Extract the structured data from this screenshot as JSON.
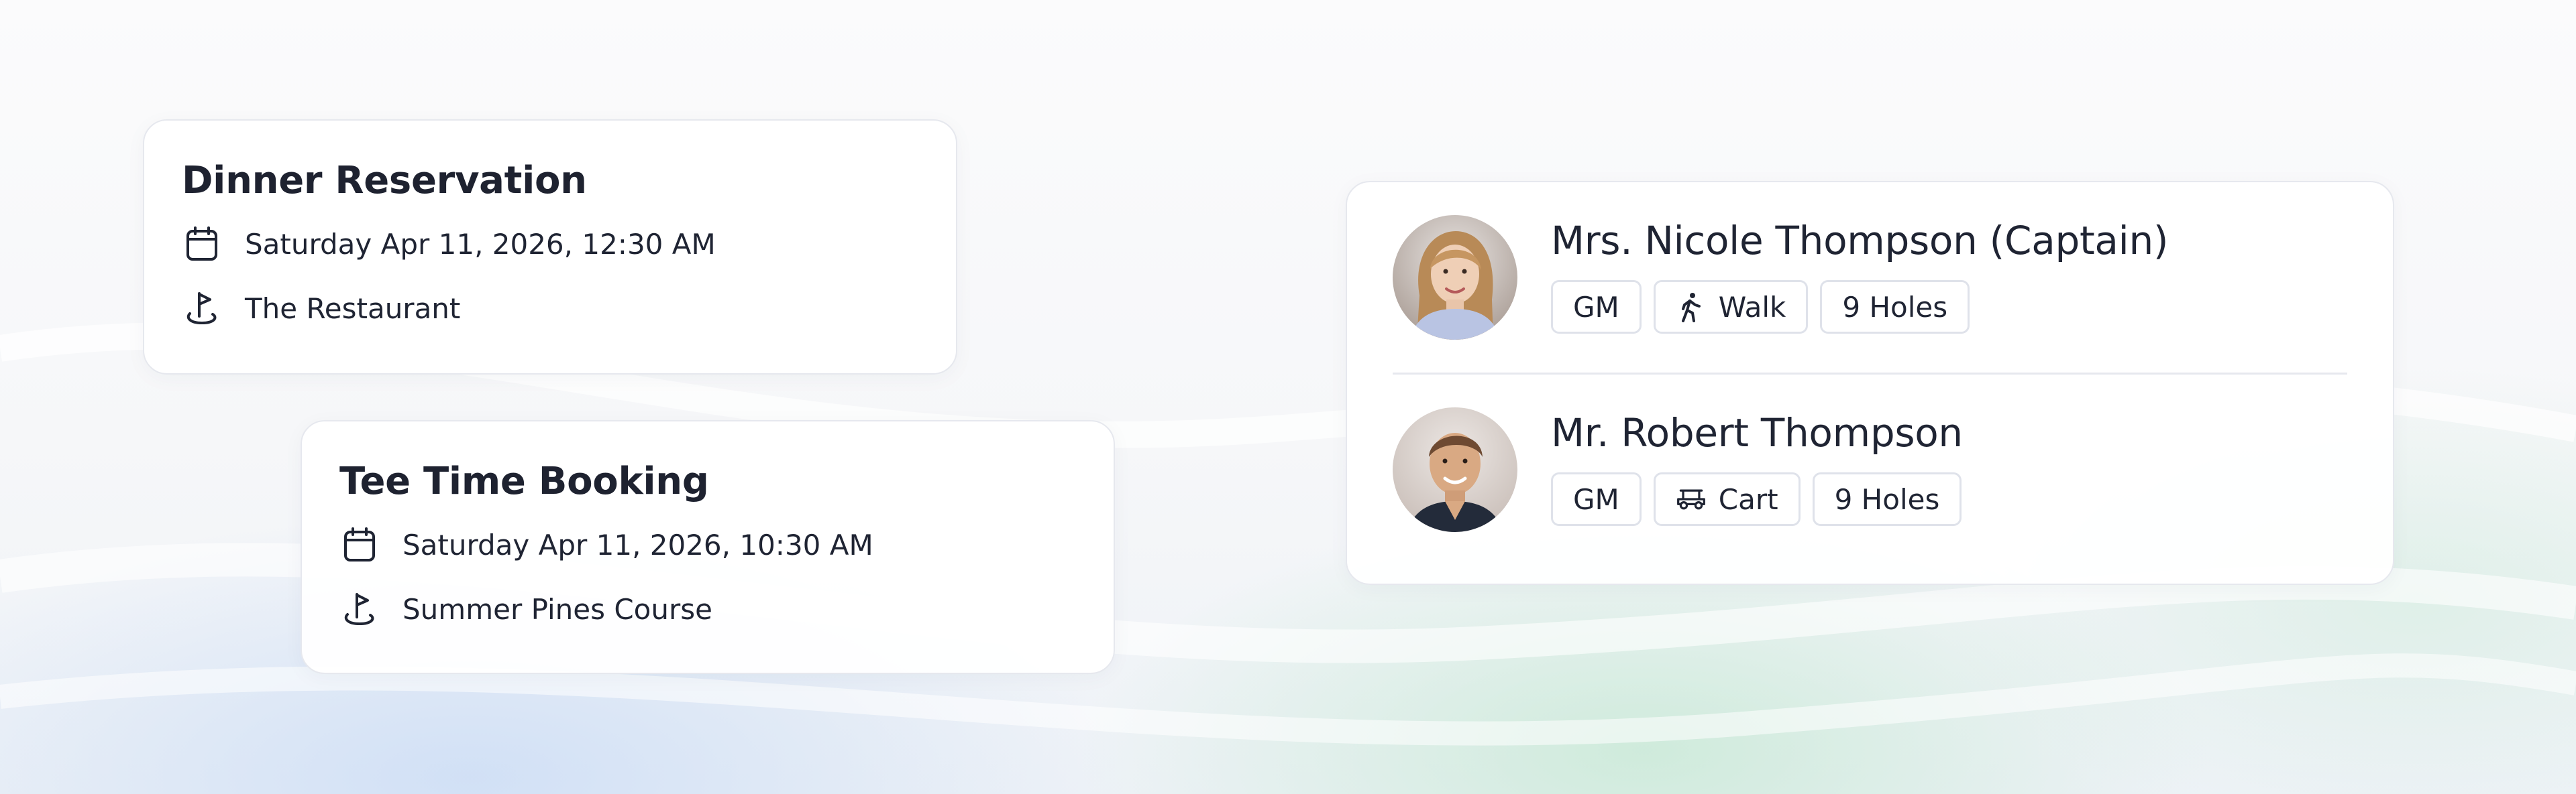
{
  "theme": {
    "text": "#1f2433",
    "card_border": "#e6e8ee",
    "tag_border": "#dfe2ea",
    "icon_color": "#1f2433"
  },
  "dinner": {
    "title": "Dinner Reservation",
    "datetime": "Saturday Apr 11, 2026, 12:30 AM",
    "location": "The Restaurant",
    "datetime_icon": "calendar-icon",
    "location_icon": "golf-flag-icon"
  },
  "tee_time": {
    "title": "Tee Time Booking",
    "datetime": "Saturday Apr 11, 2026, 10:30 AM",
    "location": "Summer Pines Course",
    "datetime_icon": "calendar-icon",
    "location_icon": "golf-flag-icon"
  },
  "players": [
    {
      "name": "Mrs. Nicole Thompson (Captain)",
      "tags": {
        "role": "GM",
        "transport": "Walk",
        "transport_icon": "walking-person-icon",
        "holes": "9 Holes"
      }
    },
    {
      "name": "Mr. Robert Thompson",
      "tags": {
        "role": "GM",
        "transport": "Cart",
        "transport_icon": "golf-cart-icon",
        "holes": "9 Holes"
      }
    }
  ]
}
